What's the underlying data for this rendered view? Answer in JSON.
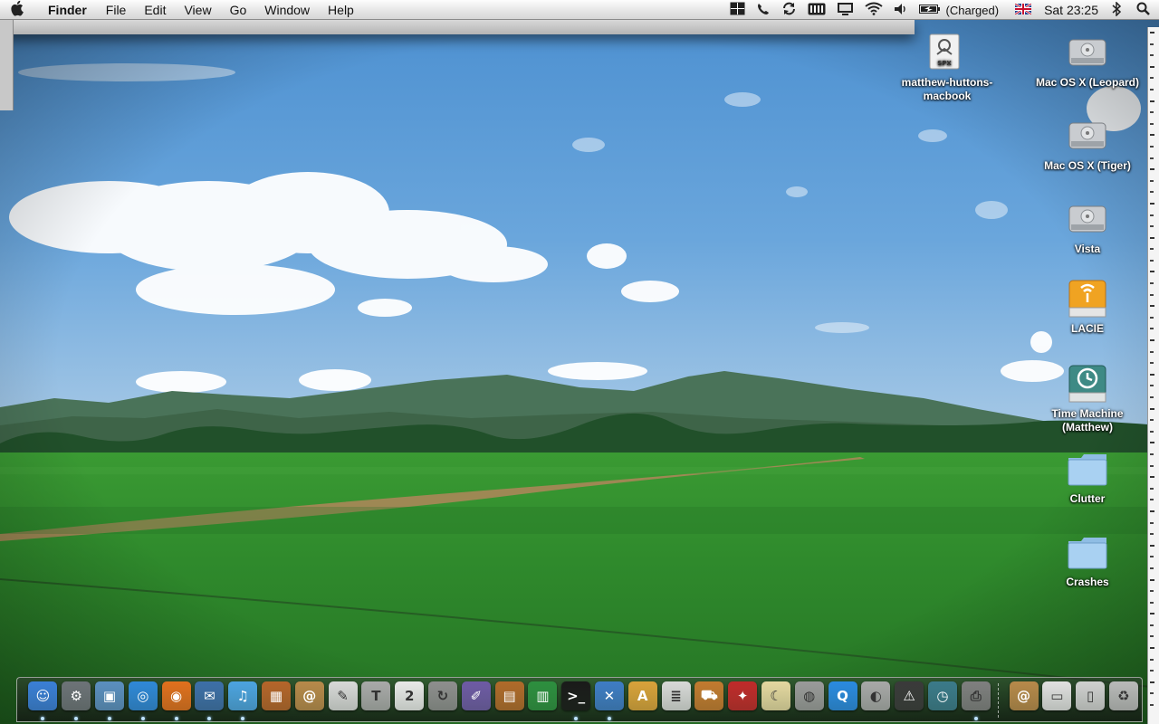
{
  "menubar": {
    "apple_icon": "apple-icon",
    "app_name": "Finder",
    "menus": [
      "File",
      "Edit",
      "View",
      "Go",
      "Window",
      "Help"
    ],
    "battery_status": "(Charged)",
    "clock": "Sat 23:25",
    "status_icons": [
      "spaces-icon",
      "skype-icon",
      "sync-icon",
      "battery-meter-icon",
      "display-icon",
      "wifi-icon",
      "volume-icon",
      "battery-icon",
      "flag-uk-icon",
      "bluetooth-icon",
      "spotlight-icon"
    ]
  },
  "desktop": {
    "icons": [
      {
        "label": "matthew-huttons-macbook",
        "line1": "matthew-huttons-",
        "line2": "macbook",
        "type": "network-server",
        "badge": "SPX"
      },
      {
        "label": "Mac OS X (Leopard)",
        "type": "hard-drive"
      },
      {
        "label": "Mac OS X (Tiger)",
        "type": "hard-drive"
      },
      {
        "label": "Vista",
        "type": "hard-drive"
      },
      {
        "label": "LACIE",
        "type": "firewire-drive"
      },
      {
        "label": "Time Machine (Matthew)",
        "line1": "Time Machine",
        "line2": "(Matthew)",
        "type": "time-machine-drive"
      },
      {
        "label": "Clutter",
        "type": "folder"
      },
      {
        "label": "Crashes",
        "type": "folder"
      }
    ],
    "colors": {
      "sky": "#3d83c8",
      "grass": "#2f8c2e",
      "mountains": "#3f6b4d",
      "trees": "#1f4a23"
    }
  },
  "dock": {
    "items": [
      {
        "name": "finder",
        "glyph": "☺",
        "color": "#3a7fd6",
        "running": true
      },
      {
        "name": "system-preferences",
        "glyph": "⚙",
        "color": "#6d7378",
        "running": true
      },
      {
        "name": "preview",
        "glyph": "▣",
        "color": "#5b8fc0",
        "running": true
      },
      {
        "name": "safari",
        "glyph": "◎",
        "color": "#2f88d8",
        "running": true
      },
      {
        "name": "firefox",
        "glyph": "◉",
        "color": "#e0701d",
        "running": true
      },
      {
        "name": "mail",
        "glyph": "✉",
        "color": "#3d6fa8",
        "running": true
      },
      {
        "name": "itunes",
        "glyph": "♫",
        "color": "#4ca3e0",
        "running": true
      },
      {
        "name": "iphoto",
        "glyph": "▦",
        "color": "#b5652a",
        "running": false
      },
      {
        "name": "address-book",
        "glyph": "@",
        "color": "#b7894a",
        "running": false
      },
      {
        "name": "textedit",
        "glyph": "✎",
        "color": "#d8d8d8",
        "running": false
      },
      {
        "name": "latex",
        "glyph": "T",
        "color": "#a9a9a9",
        "running": false
      },
      {
        "name": "ical",
        "glyph": "2",
        "color": "#e8e8e8",
        "running": false
      },
      {
        "name": "sync",
        "glyph": "↻",
        "color": "#8e8e8e",
        "running": false
      },
      {
        "name": "script-editor",
        "glyph": "✐",
        "color": "#6e5aa5",
        "running": false
      },
      {
        "name": "keynote",
        "glyph": "▤",
        "color": "#b06a2a",
        "running": false
      },
      {
        "name": "numbers",
        "glyph": "▥",
        "color": "#2d8f3f",
        "running": false
      },
      {
        "name": "terminal",
        "glyph": ">_",
        "color": "#1a1a1a",
        "running": true
      },
      {
        "name": "xcode",
        "glyph": "✕",
        "color": "#3e7cc4",
        "running": true
      },
      {
        "name": "pages",
        "glyph": "A",
        "color": "#d9a23a",
        "running": false
      },
      {
        "name": "textwrangler",
        "glyph": "≣",
        "color": "#d8d8d8",
        "running": false
      },
      {
        "name": "transmit",
        "glyph": "⛟",
        "color": "#c27a2f",
        "running": false
      },
      {
        "name": "acrobat",
        "glyph": "✦",
        "color": "#c02a2a",
        "running": false
      },
      {
        "name": "taco",
        "glyph": "☾",
        "color": "#e4d7a0",
        "running": false
      },
      {
        "name": "disk-utility",
        "glyph": "◍",
        "color": "#9a9a9a",
        "running": false
      },
      {
        "name": "quicktime",
        "glyph": "Q",
        "color": "#2a8ae0",
        "running": false
      },
      {
        "name": "cd-burner",
        "glyph": "◐",
        "color": "#a8a8a8",
        "running": false
      },
      {
        "name": "console",
        "glyph": "⚠",
        "color": "#3a3a3a",
        "running": false
      },
      {
        "name": "time-machine",
        "glyph": "◷",
        "color": "#3b7a8a",
        "running": false
      },
      {
        "name": "printer",
        "glyph": "⎙",
        "color": "#7f7f7f",
        "running": true
      }
    ],
    "stacks": [
      {
        "name": "applications-stack",
        "glyph": "@",
        "color": "#b7894a"
      },
      {
        "name": "documents-stack",
        "glyph": "▭",
        "color": "#e0e0e0"
      },
      {
        "name": "downloads-stack",
        "glyph": "▯",
        "color": "#d0d0d0"
      },
      {
        "name": "trash",
        "glyph": "♻",
        "color": "#b9b9b9"
      }
    ]
  }
}
